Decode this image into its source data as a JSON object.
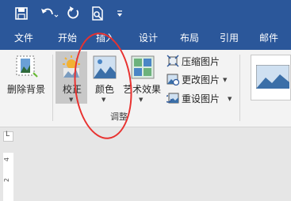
{
  "tabs": [
    "文件",
    "开始",
    "插入",
    "设计",
    "布局",
    "引用",
    "邮件"
  ],
  "ribbon": {
    "remove_bg": "删除背景",
    "correct": "校正",
    "color": "颜色",
    "art_effects": "艺术效果",
    "compress": "压缩图片",
    "change": "更改图片",
    "reset": "重设图片",
    "group_adjust": "调整"
  },
  "ruler": {
    "marks": [
      "4",
      "2"
    ],
    "corner": "L"
  },
  "colors": {
    "brand": "#2b579a",
    "annotation": "#e8312f"
  }
}
